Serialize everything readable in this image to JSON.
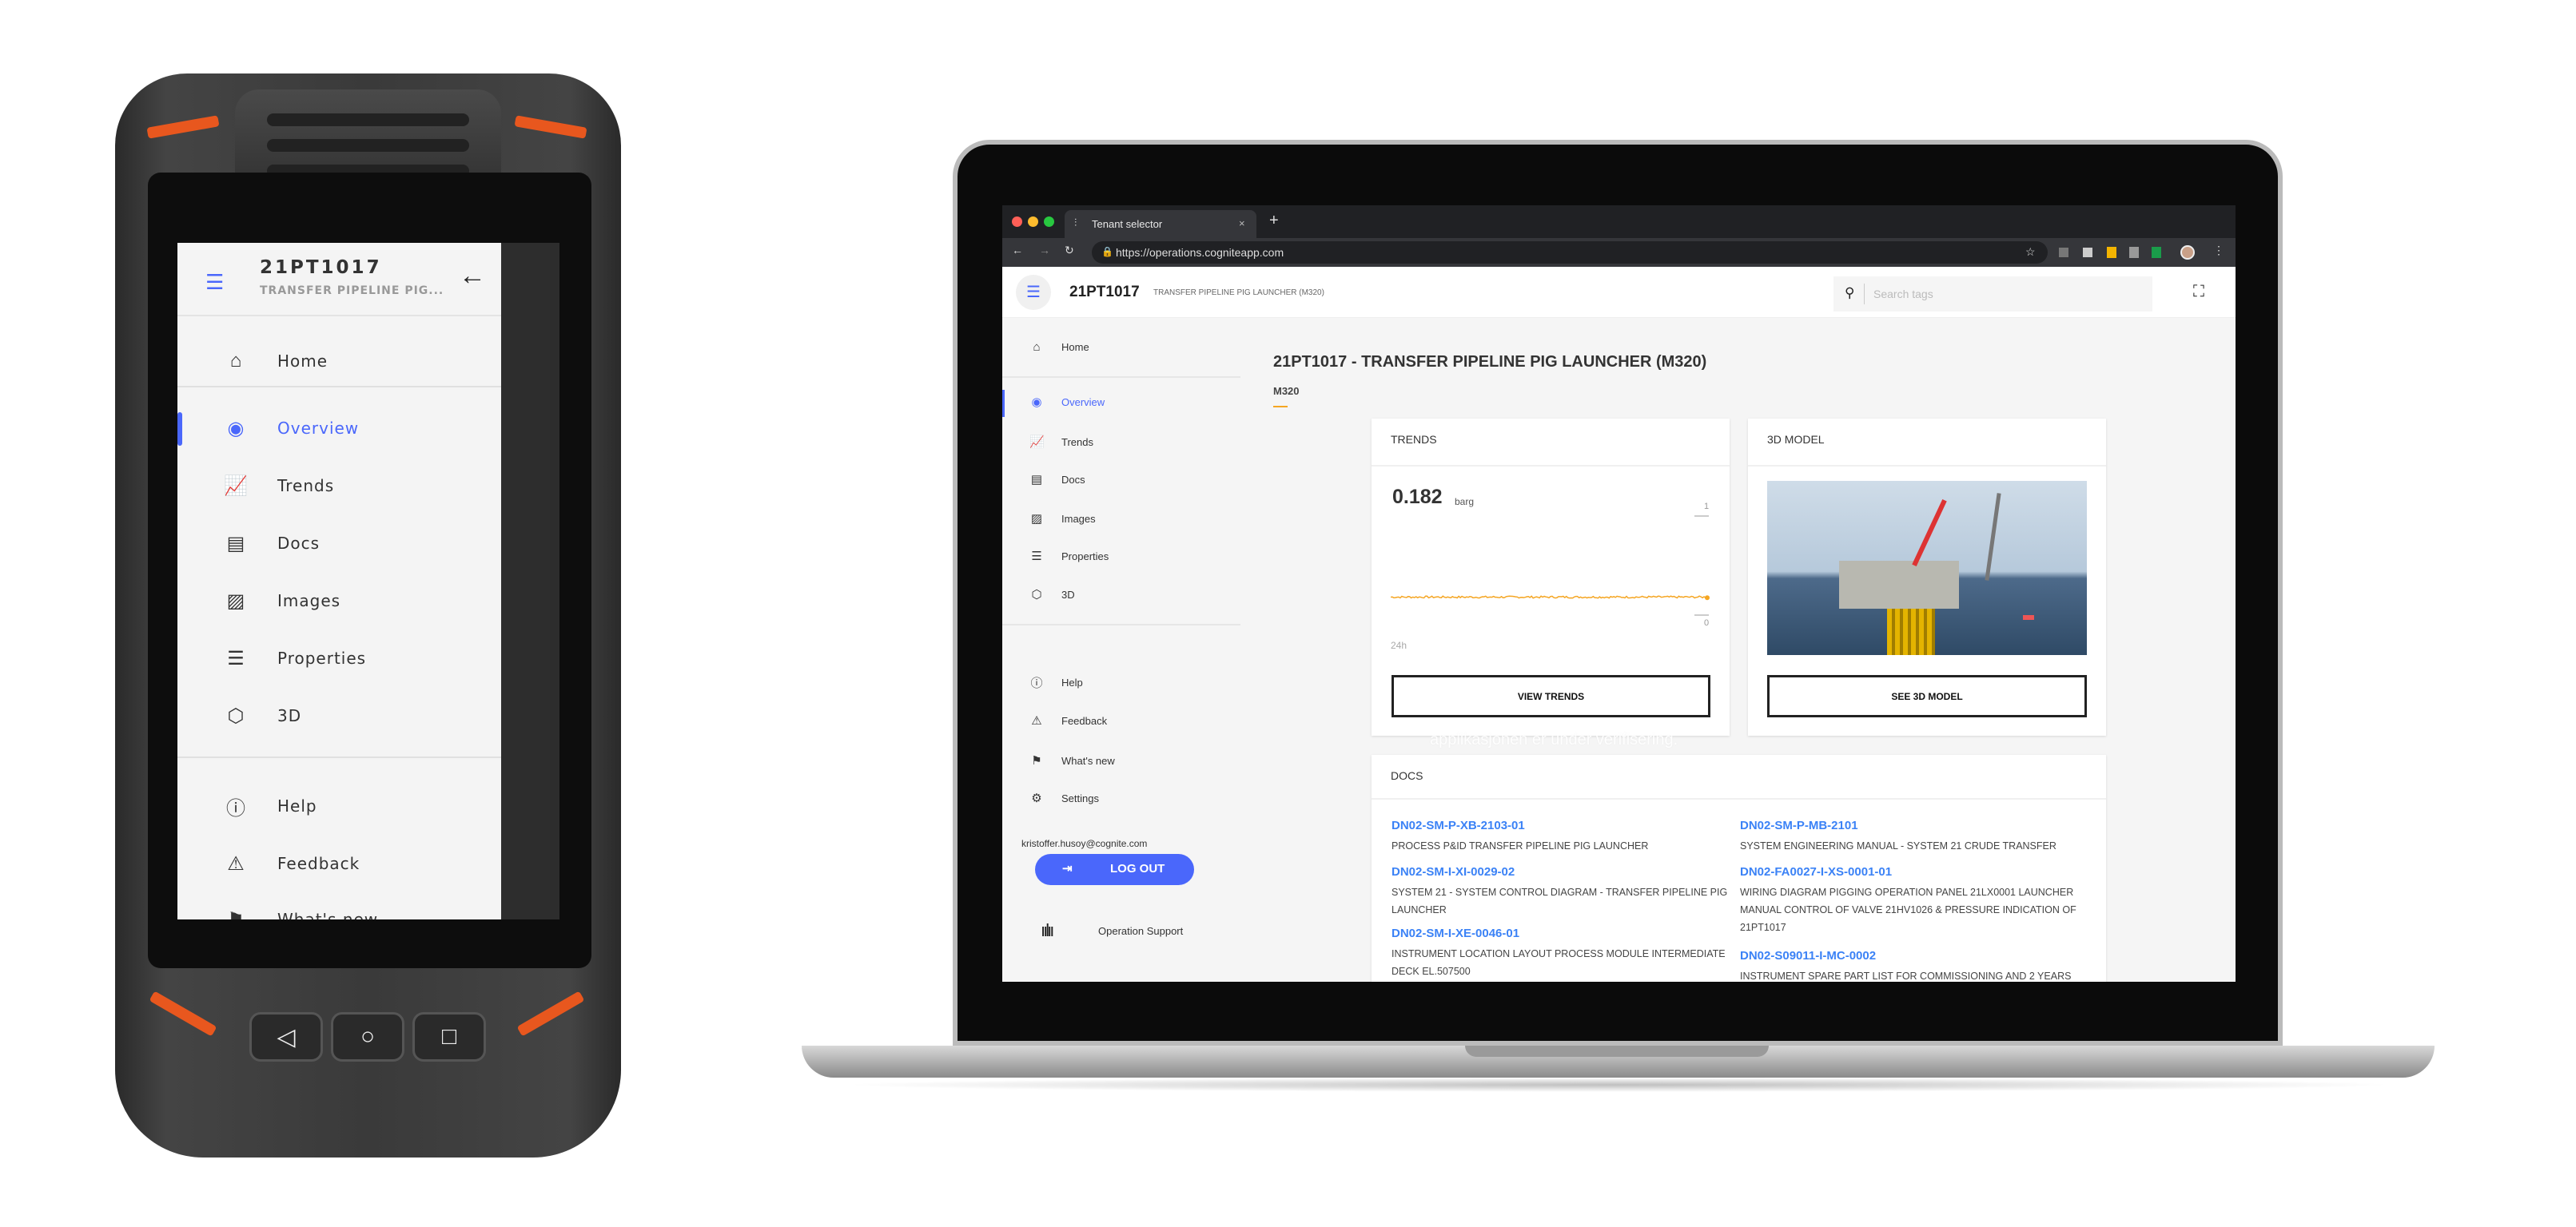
{
  "phone": {
    "header": {
      "title": "21PT1017",
      "subtitle": "TRANSFER PIPELINE PIG..."
    },
    "nav_items": [
      {
        "label": "Home",
        "icon": "home-icon"
      },
      {
        "label": "Overview",
        "icon": "eye-icon",
        "active": true
      },
      {
        "label": "Trends",
        "icon": "chart-icon"
      },
      {
        "label": "Docs",
        "icon": "document-icon"
      },
      {
        "label": "Images",
        "icon": "image-icon"
      },
      {
        "label": "Properties",
        "icon": "list-icon"
      },
      {
        "label": "3D",
        "icon": "cube-icon"
      },
      {
        "label": "Help",
        "icon": "help-icon"
      },
      {
        "label": "Feedback",
        "icon": "feedback-icon"
      },
      {
        "label": "What's new",
        "icon": "flag-icon"
      }
    ]
  },
  "browser": {
    "tab_title": "Tenant selector",
    "url": "https://operations.cogniteapp.com"
  },
  "app": {
    "header": {
      "tag": "21PT1017",
      "description": "TRANSFER PIPELINE PIG LAUNCHER (M320)",
      "search_placeholder": "Search tags"
    },
    "sidebar": {
      "items": [
        {
          "label": "Home",
          "icon": "home-icon"
        },
        {
          "label": "Overview",
          "icon": "eye-icon",
          "active": true
        },
        {
          "label": "Trends",
          "icon": "chart-icon"
        },
        {
          "label": "Docs",
          "icon": "document-icon"
        },
        {
          "label": "Images",
          "icon": "image-icon"
        },
        {
          "label": "Properties",
          "icon": "list-icon"
        },
        {
          "label": "3D",
          "icon": "cube-icon"
        },
        {
          "label": "Help",
          "icon": "help-icon"
        },
        {
          "label": "Feedback",
          "icon": "feedback-icon"
        },
        {
          "label": "What's new",
          "icon": "flag-icon"
        },
        {
          "label": "Settings",
          "icon": "gear-icon"
        }
      ],
      "email": "kristoffer.husoy@cognite.com",
      "logout_label": "LOG OUT",
      "brand": "Operation Support"
    },
    "main": {
      "title": "21PT1017 - TRANSFER PIPELINE PIG LAUNCHER (M320)",
      "subtitle": "M320",
      "trends": {
        "header": "TRENDS",
        "value": "0.182",
        "unit": "barg",
        "ymax_label": "1",
        "ymin_label": "0",
        "range_label": "24h",
        "button": "VIEW TRENDS",
        "series_value": 0.182,
        "ylim": [
          0,
          1
        ],
        "line_color": "#f5a623"
      },
      "model": {
        "header": "3D MODEL",
        "button": "SEE 3D MODEL"
      },
      "watermark": "applikasjonen er under verifisering.",
      "docs": {
        "header": "DOCS",
        "left": [
          {
            "id": "DN02-SM-P-XB-2103-01",
            "desc": "PROCESS P&ID TRANSFER PIPELINE PIG LAUNCHER"
          },
          {
            "id": "DN02-SM-I-XI-0029-02",
            "desc": "SYSTEM 21 - SYSTEM CONTROL DIAGRAM - TRANSFER PIPELINE PIG LAUNCHER"
          },
          {
            "id": "DN02-SM-I-XE-0046-01",
            "desc": "INSTRUMENT LOCATION LAYOUT PROCESS MODULE INTERMEDIATE DECK EL.507500"
          }
        ],
        "right": [
          {
            "id": "DN02-SM-P-MB-2101",
            "desc": "SYSTEM ENGINEERING MANUAL - SYSTEM 21 CRUDE TRANSFER"
          },
          {
            "id": "DN02-FA0027-I-XS-0001-01",
            "desc": "WIRING DIAGRAM PIGGING OPERATION PANEL 21LX0001 LAUNCHER MANUAL CONTROL OF VALVE 21HV1026 & PRESSURE INDICATION OF 21PT1017"
          },
          {
            "id": "DN02-S09011-I-MC-0002",
            "desc": "INSTRUMENT SPARE PART LIST FOR COMMISSIONING AND 2 YEARS"
          }
        ]
      }
    },
    "accent_color": "#4a67fb"
  }
}
